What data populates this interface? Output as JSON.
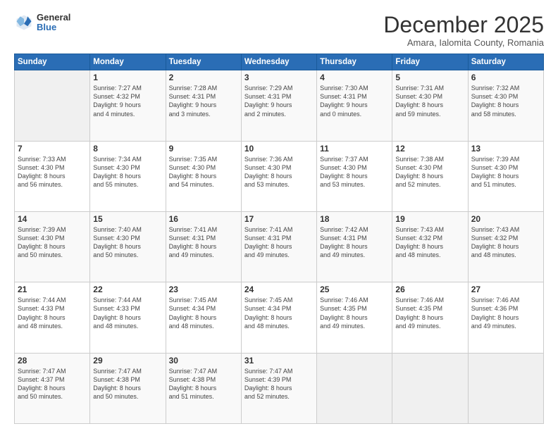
{
  "logo": {
    "general": "General",
    "blue": "Blue"
  },
  "header": {
    "month": "December 2025",
    "location": "Amara, Ialomita County, Romania"
  },
  "weekdays": [
    "Sunday",
    "Monday",
    "Tuesday",
    "Wednesday",
    "Thursday",
    "Friday",
    "Saturday"
  ],
  "weeks": [
    [
      {
        "day": "",
        "info": ""
      },
      {
        "day": "1",
        "info": "Sunrise: 7:27 AM\nSunset: 4:32 PM\nDaylight: 9 hours\nand 4 minutes."
      },
      {
        "day": "2",
        "info": "Sunrise: 7:28 AM\nSunset: 4:31 PM\nDaylight: 9 hours\nand 3 minutes."
      },
      {
        "day": "3",
        "info": "Sunrise: 7:29 AM\nSunset: 4:31 PM\nDaylight: 9 hours\nand 2 minutes."
      },
      {
        "day": "4",
        "info": "Sunrise: 7:30 AM\nSunset: 4:31 PM\nDaylight: 9 hours\nand 0 minutes."
      },
      {
        "day": "5",
        "info": "Sunrise: 7:31 AM\nSunset: 4:30 PM\nDaylight: 8 hours\nand 59 minutes."
      },
      {
        "day": "6",
        "info": "Sunrise: 7:32 AM\nSunset: 4:30 PM\nDaylight: 8 hours\nand 58 minutes."
      }
    ],
    [
      {
        "day": "7",
        "info": "Sunrise: 7:33 AM\nSunset: 4:30 PM\nDaylight: 8 hours\nand 56 minutes."
      },
      {
        "day": "8",
        "info": "Sunrise: 7:34 AM\nSunset: 4:30 PM\nDaylight: 8 hours\nand 55 minutes."
      },
      {
        "day": "9",
        "info": "Sunrise: 7:35 AM\nSunset: 4:30 PM\nDaylight: 8 hours\nand 54 minutes."
      },
      {
        "day": "10",
        "info": "Sunrise: 7:36 AM\nSunset: 4:30 PM\nDaylight: 8 hours\nand 53 minutes."
      },
      {
        "day": "11",
        "info": "Sunrise: 7:37 AM\nSunset: 4:30 PM\nDaylight: 8 hours\nand 53 minutes."
      },
      {
        "day": "12",
        "info": "Sunrise: 7:38 AM\nSunset: 4:30 PM\nDaylight: 8 hours\nand 52 minutes."
      },
      {
        "day": "13",
        "info": "Sunrise: 7:39 AM\nSunset: 4:30 PM\nDaylight: 8 hours\nand 51 minutes."
      }
    ],
    [
      {
        "day": "14",
        "info": "Sunrise: 7:39 AM\nSunset: 4:30 PM\nDaylight: 8 hours\nand 50 minutes."
      },
      {
        "day": "15",
        "info": "Sunrise: 7:40 AM\nSunset: 4:30 PM\nDaylight: 8 hours\nand 50 minutes."
      },
      {
        "day": "16",
        "info": "Sunrise: 7:41 AM\nSunset: 4:31 PM\nDaylight: 8 hours\nand 49 minutes."
      },
      {
        "day": "17",
        "info": "Sunrise: 7:41 AM\nSunset: 4:31 PM\nDaylight: 8 hours\nand 49 minutes."
      },
      {
        "day": "18",
        "info": "Sunrise: 7:42 AM\nSunset: 4:31 PM\nDaylight: 8 hours\nand 49 minutes."
      },
      {
        "day": "19",
        "info": "Sunrise: 7:43 AM\nSunset: 4:32 PM\nDaylight: 8 hours\nand 48 minutes."
      },
      {
        "day": "20",
        "info": "Sunrise: 7:43 AM\nSunset: 4:32 PM\nDaylight: 8 hours\nand 48 minutes."
      }
    ],
    [
      {
        "day": "21",
        "info": "Sunrise: 7:44 AM\nSunset: 4:33 PM\nDaylight: 8 hours\nand 48 minutes."
      },
      {
        "day": "22",
        "info": "Sunrise: 7:44 AM\nSunset: 4:33 PM\nDaylight: 8 hours\nand 48 minutes."
      },
      {
        "day": "23",
        "info": "Sunrise: 7:45 AM\nSunset: 4:34 PM\nDaylight: 8 hours\nand 48 minutes."
      },
      {
        "day": "24",
        "info": "Sunrise: 7:45 AM\nSunset: 4:34 PM\nDaylight: 8 hours\nand 48 minutes."
      },
      {
        "day": "25",
        "info": "Sunrise: 7:46 AM\nSunset: 4:35 PM\nDaylight: 8 hours\nand 49 minutes."
      },
      {
        "day": "26",
        "info": "Sunrise: 7:46 AM\nSunset: 4:35 PM\nDaylight: 8 hours\nand 49 minutes."
      },
      {
        "day": "27",
        "info": "Sunrise: 7:46 AM\nSunset: 4:36 PM\nDaylight: 8 hours\nand 49 minutes."
      }
    ],
    [
      {
        "day": "28",
        "info": "Sunrise: 7:47 AM\nSunset: 4:37 PM\nDaylight: 8 hours\nand 50 minutes."
      },
      {
        "day": "29",
        "info": "Sunrise: 7:47 AM\nSunset: 4:38 PM\nDaylight: 8 hours\nand 50 minutes."
      },
      {
        "day": "30",
        "info": "Sunrise: 7:47 AM\nSunset: 4:38 PM\nDaylight: 8 hours\nand 51 minutes."
      },
      {
        "day": "31",
        "info": "Sunrise: 7:47 AM\nSunset: 4:39 PM\nDaylight: 8 hours\nand 52 minutes."
      },
      {
        "day": "",
        "info": ""
      },
      {
        "day": "",
        "info": ""
      },
      {
        "day": "",
        "info": ""
      }
    ]
  ]
}
